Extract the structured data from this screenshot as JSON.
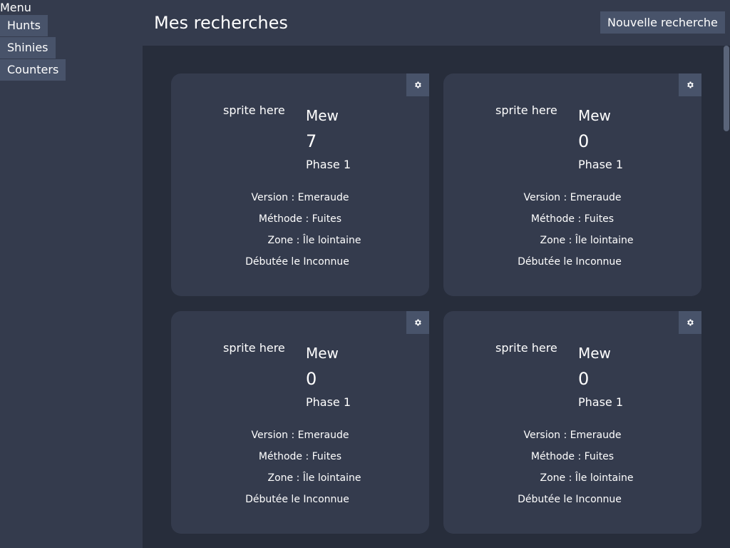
{
  "sidebar": {
    "title": "Menu",
    "items": [
      {
        "label": "Hunts"
      },
      {
        "label": "Shinies"
      },
      {
        "label": "Counters"
      }
    ]
  },
  "header": {
    "title": "Mes recherches",
    "new_button": "Nouvelle recherche"
  },
  "cards": [
    {
      "sprite": "sprite here",
      "name": "Mew",
      "count": "7",
      "phase": "Phase 1",
      "version": "Version : Emeraude",
      "method": "Méthode : Fuites",
      "zone": "Zone : Île lointaine",
      "started": "Débutée le Inconnue"
    },
    {
      "sprite": "sprite here",
      "name": "Mew",
      "count": "0",
      "phase": "Phase 1",
      "version": "Version : Emeraude",
      "method": "Méthode : Fuites",
      "zone": "Zone : Île lointaine",
      "started": "Débutée le Inconnue"
    },
    {
      "sprite": "sprite here",
      "name": "Mew",
      "count": "0",
      "phase": "Phase 1",
      "version": "Version : Emeraude",
      "method": "Méthode : Fuites",
      "zone": "Zone : Île lointaine",
      "started": "Débutée le Inconnue"
    },
    {
      "sprite": "sprite here",
      "name": "Mew",
      "count": "0",
      "phase": "Phase 1",
      "version": "Version : Emeraude",
      "method": "Méthode : Fuites",
      "zone": "Zone : Île lointaine",
      "started": "Débutée le Inconnue"
    }
  ],
  "icons": {
    "settings": "gear-icon"
  },
  "colors": {
    "background": "#343b4d",
    "content": "#272d3b",
    "button": "#48536a",
    "text": "#ffffff"
  }
}
